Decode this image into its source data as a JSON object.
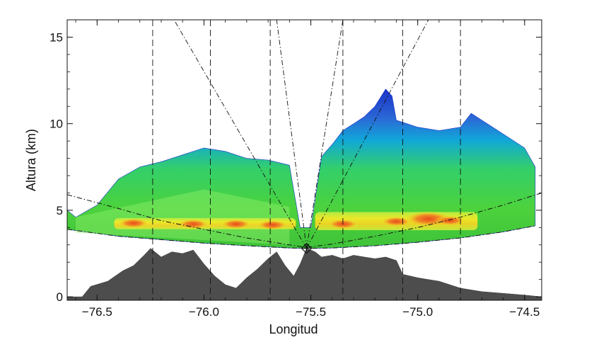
{
  "chart_data": {
    "type": "radar_cross_section",
    "title": "",
    "xlabel": "Longitud",
    "ylabel": "Altura (km)",
    "xlim": [
      -76.64,
      -74.42
    ],
    "ylim": [
      -0.2,
      16.0
    ],
    "xticks": [
      -76.5,
      -76.0,
      -75.5,
      -75.0,
      -74.5
    ],
    "xtick_labels": [
      "−76.5",
      "−76.0",
      "−75.5",
      "−75.0",
      "−74.5"
    ],
    "yticks": [
      0,
      5,
      10,
      15
    ],
    "ytick_labels": [
      "0",
      "5",
      "10",
      "15"
    ],
    "grid": false,
    "radar_site": {
      "lon": -75.52,
      "alt": 2.8
    },
    "colors": {
      "terrain": "#4d4d4d",
      "echo_top": "#1b33c9",
      "echo_upper": "#11a7d8",
      "echo_green": "#4cd23c",
      "echo_light": "#8ef06a",
      "bright_band": "#f2ea28",
      "core": "#f08b24",
      "core_max": "#e84c1c"
    },
    "terrain": {
      "lon": [
        -76.64,
        -76.57,
        -76.53,
        -76.45,
        -76.38,
        -76.33,
        -76.28,
        -76.25,
        -76.2,
        -76.15,
        -76.1,
        -76.05,
        -76.0,
        -75.95,
        -75.9,
        -75.85,
        -75.8,
        -75.75,
        -75.7,
        -75.66,
        -75.62,
        -75.58,
        -75.55,
        -75.52,
        -75.48,
        -75.45,
        -75.4,
        -75.35,
        -75.3,
        -75.25,
        -75.2,
        -75.15,
        -75.1,
        -75.07,
        -75.0,
        -74.95,
        -74.9,
        -74.85,
        -74.8,
        -74.7,
        -74.6,
        -74.5,
        -74.42
      ],
      "alt": [
        0.0,
        0.0,
        0.6,
        0.9,
        1.5,
        1.8,
        2.4,
        2.8,
        2.3,
        2.6,
        2.5,
        2.7,
        1.9,
        1.2,
        0.7,
        0.5,
        1.1,
        1.6,
        2.2,
        2.6,
        1.8,
        1.2,
        1.9,
        2.8,
        2.6,
        2.3,
        2.4,
        2.2,
        2.4,
        2.3,
        2.2,
        2.3,
        2.1,
        1.3,
        1.1,
        1.0,
        0.9,
        0.7,
        0.5,
        0.3,
        0.2,
        0.1,
        0.0
      ]
    },
    "echo_top": {
      "lon": [
        -76.64,
        -76.6,
        -76.5,
        -76.4,
        -76.3,
        -76.2,
        -76.1,
        -76.0,
        -75.9,
        -75.8,
        -75.7,
        -75.6,
        -75.55,
        -75.5,
        -75.45,
        -75.4,
        -75.35,
        -75.3,
        -75.25,
        -75.2,
        -75.15,
        -75.12,
        -75.1,
        -75.05,
        -75.0,
        -74.9,
        -74.8,
        -74.75,
        -74.7,
        -74.6,
        -74.5,
        -74.45
      ],
      "alt": [
        5.0,
        4.6,
        5.3,
        6.8,
        7.5,
        7.8,
        8.2,
        8.6,
        8.4,
        8.0,
        7.9,
        7.6,
        4.0,
        4.0,
        8.1,
        8.8,
        9.6,
        10.0,
        10.4,
        11.0,
        12.0,
        11.6,
        10.2,
        10.0,
        9.8,
        9.6,
        9.8,
        10.6,
        10.2,
        9.4,
        8.6,
        7.5
      ]
    },
    "blue_bottom": {
      "lon": [
        -76.1,
        -76.0,
        -75.9,
        -75.8,
        -75.7,
        -75.6,
        -75.55,
        -75.45,
        -75.4,
        -75.35,
        -75.3,
        -75.25,
        -75.2,
        -75.15,
        -75.1,
        -75.05
      ],
      "alt": [
        7.4,
        7.2,
        6.8,
        6.4,
        6.2,
        5.9,
        4.2,
        6.2,
        7.0,
        8.2,
        8.6,
        8.9,
        9.4,
        9.6,
        9.6,
        9.2
      ]
    },
    "scan_lower": {
      "lon": [
        -76.64,
        -76.4,
        -76.2,
        -76.0,
        -75.8,
        -75.6,
        -75.52,
        -75.4,
        -75.2,
        -75.0,
        -74.8,
        -74.6,
        -74.45
      ],
      "alt": [
        3.9,
        3.5,
        3.3,
        3.1,
        2.95,
        2.82,
        2.8,
        2.82,
        2.95,
        3.15,
        3.4,
        3.75,
        4.1
      ]
    },
    "scan_upper": {
      "lon": [
        -76.64,
        -76.4,
        -76.2,
        -76.0,
        -75.8,
        -75.6,
        -75.52,
        -75.4,
        -75.2,
        -75.0,
        -74.8,
        -74.6,
        -74.42
      ],
      "alt": [
        5.9,
        5.1,
        4.4,
        3.9,
        3.4,
        3.0,
        2.85,
        3.05,
        3.5,
        4.0,
        4.6,
        5.3,
        6.0
      ]
    },
    "bright_band": [
      {
        "lon_start": -76.42,
        "lon_end": -75.57,
        "alt_bottom": 3.9,
        "alt_top": 4.55
      },
      {
        "lon_start": -75.48,
        "lon_end": -74.72,
        "alt_bottom": 3.85,
        "alt_top": 4.9
      }
    ],
    "reflectivity_cores": [
      {
        "lon": -76.33,
        "alt": 4.25,
        "kind": "bright_band"
      },
      {
        "lon": -76.05,
        "alt": 4.2,
        "kind": "core"
      },
      {
        "lon": -75.85,
        "alt": 4.2,
        "kind": "core"
      },
      {
        "lon": -75.68,
        "alt": 4.15,
        "kind": "core"
      },
      {
        "lon": -75.35,
        "alt": 4.2,
        "kind": "core"
      },
      {
        "lon": -75.1,
        "alt": 4.35,
        "kind": "core"
      },
      {
        "lon": -74.95,
        "alt": 4.5,
        "kind": "core_max"
      },
      {
        "lon": -74.85,
        "alt": 4.4,
        "kind": "core"
      }
    ],
    "dashed_vertical_lines": [
      -76.24,
      -75.97,
      -75.69,
      -75.35,
      -75.07,
      -74.8
    ],
    "radial_lines": [
      {
        "lon_top": -75.66,
        "alt_top": 16.0
      },
      {
        "lon_top": -75.35,
        "alt_top": 16.0
      },
      {
        "lon_top": -76.14,
        "alt_top": 16.0
      },
      {
        "lon_top": -74.95,
        "alt_top": 16.0
      }
    ]
  }
}
